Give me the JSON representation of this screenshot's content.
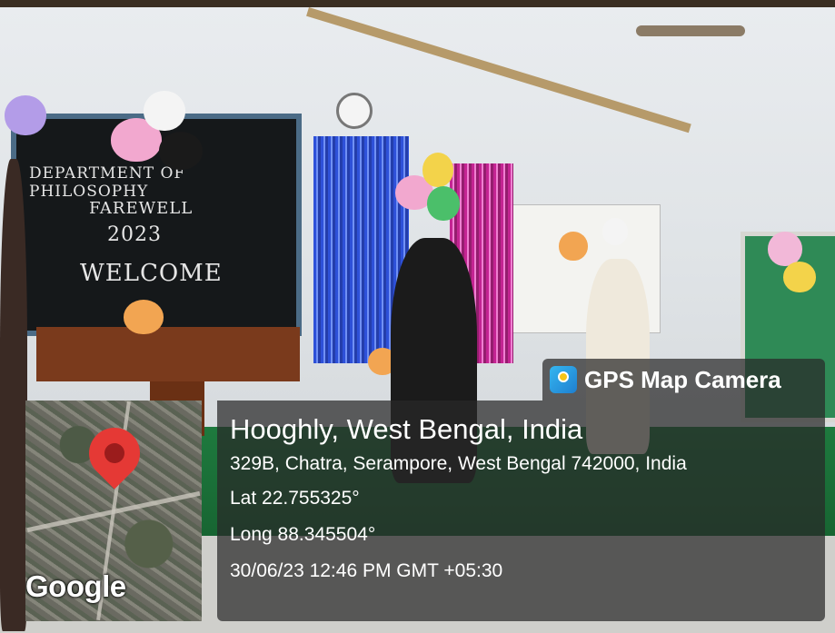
{
  "scene": {
    "board": {
      "line1": "DEPARTMENT OF PHILOSOPHY",
      "line2": "FAREWELL",
      "line3": "2023",
      "line4": "WELCOME"
    }
  },
  "overlay": {
    "app_name": "GPS Map Camera",
    "app_icon": "gps-map-camera-icon",
    "map_icon": "location-pin-icon",
    "map_brand": "Google",
    "place": "Hooghly, West Bengal, India",
    "address": "329B, Chatra, Serampore, West Bengal 742000, India",
    "lat": "Lat 22.755325°",
    "long": "Long 88.345504°",
    "datetime": "30/06/23 12:46 PM GMT +05:30"
  },
  "colors": {
    "overlay_bg": "#282828",
    "pin": "#e53935",
    "stage": "#1e7a3e"
  }
}
